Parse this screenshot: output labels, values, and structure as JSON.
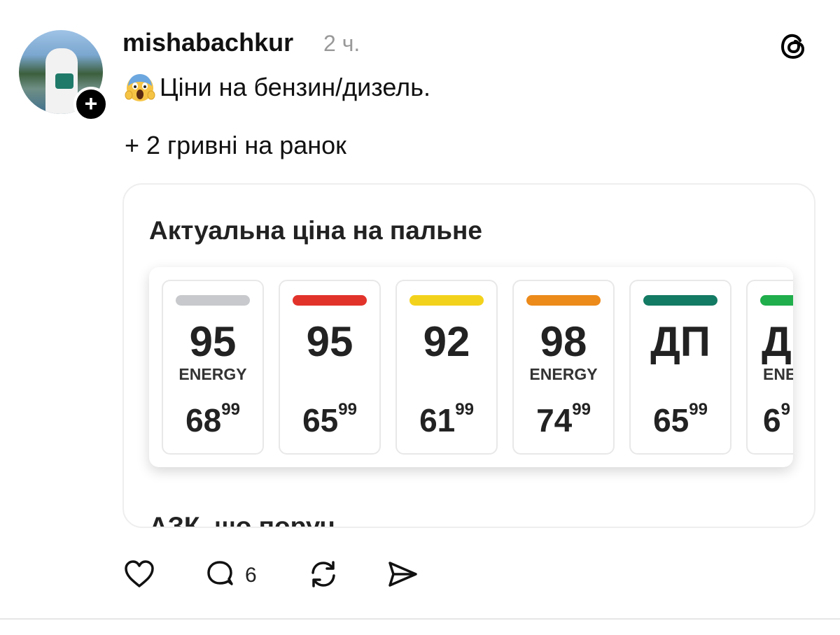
{
  "post": {
    "username": "mishabachkur",
    "time": "2 ч.",
    "text_line1": "Ціни на бензин/дизель.",
    "text_line2": "+ 2 гривні на ранок",
    "emoji": "face-screaming-in-fear",
    "follow_symbol": "+"
  },
  "link_card": {
    "title": "Актуальна ціна на пальне",
    "subtitle_cutoff": "АЗК, що поруч",
    "fuels": [
      {
        "grade": "95",
        "tag": "ENERGY",
        "price_main": "68",
        "price_cents": "99",
        "color": "#c7c9cc"
      },
      {
        "grade": "95",
        "tag": "",
        "price_main": "65",
        "price_cents": "99",
        "color": "#e2332b"
      },
      {
        "grade": "92",
        "tag": "",
        "price_main": "61",
        "price_cents": "99",
        "color": "#f3d21c"
      },
      {
        "grade": "98",
        "tag": "ENERGY",
        "price_main": "74",
        "price_cents": "99",
        "color": "#ec8a1a"
      },
      {
        "grade": "ДП",
        "tag": "",
        "price_main": "65",
        "price_cents": "99",
        "color": "#137a63"
      },
      {
        "grade": "Д",
        "tag": "ENE",
        "price_main": "6",
        "price_cents": "9",
        "color": "#1fae4b"
      }
    ]
  },
  "actions": {
    "comment_count": "6",
    "icons": [
      "heart-icon",
      "comment-icon",
      "repost-icon",
      "share-icon"
    ]
  }
}
